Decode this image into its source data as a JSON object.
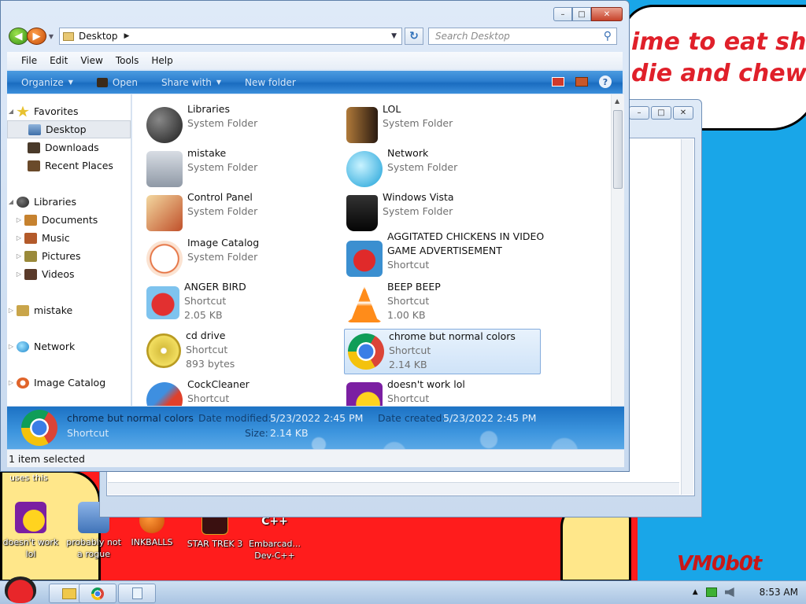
{
  "wallpaper": {
    "text": "ime to eat shi\ndie and chew\nm",
    "signature": "VM0b0t",
    "uses_this": "uses this"
  },
  "desktop_icons": [
    {
      "label": "doesn't work lol",
      "icon": "yahoo-messenger-icon"
    },
    {
      "label": "probably not a rogue",
      "icon": "gear-computer-icon"
    },
    {
      "label": "INKBALLS",
      "icon": "inkball-icon"
    },
    {
      "label": "STAR TREK 3",
      "icon": "star-wars-icon"
    },
    {
      "label": "Embarcad... Dev-C++",
      "icon": "dev-cpp-icon"
    }
  ],
  "explorer": {
    "address": "Desktop",
    "search_placeholder": "Search Desktop",
    "menu": [
      "File",
      "Edit",
      "View",
      "Tools",
      "Help"
    ],
    "commands": {
      "organize": "Organize",
      "open": "Open",
      "share": "Share with",
      "new_folder": "New folder"
    },
    "nav": {
      "favorites": "Favorites",
      "desktop": "Desktop",
      "downloads": "Downloads",
      "recent": "Recent Places",
      "libraries": "Libraries",
      "documents": "Documents",
      "music": "Music",
      "pictures": "Pictures",
      "videos": "Videos",
      "mistake": "mistake",
      "network": "Network",
      "image_catalog": "Image Catalog"
    },
    "items": [
      {
        "name": "Libraries",
        "type": "System Folder",
        "size": "",
        "icon": "libraries-icon"
      },
      {
        "name": "LOL",
        "type": "System Folder",
        "size": "",
        "icon": "user-folder-icon"
      },
      {
        "name": "mistake",
        "type": "System Folder",
        "size": "",
        "icon": "computer-icon"
      },
      {
        "name": "Network",
        "type": "System Folder",
        "size": "",
        "icon": "network-globe-icon"
      },
      {
        "name": "Control Panel",
        "type": "System Folder",
        "size": "",
        "icon": "control-panel-icon"
      },
      {
        "name": "Windows Vista",
        "type": "System Folder",
        "size": "",
        "icon": "recycle-bin-icon"
      },
      {
        "name": "Image Catalog",
        "type": "System Folder",
        "size": "",
        "icon": "image-catalog-icon"
      },
      {
        "name": "AGGITATED CHICKENS IN VIDEO GAME ADVERTISEMENT",
        "type": "Shortcut",
        "size": "",
        "icon": "angry-birds-icon"
      },
      {
        "name": "ANGER BIRD",
        "type": "Shortcut",
        "size": "2.05 KB",
        "icon": "angry-bird-icon"
      },
      {
        "name": "BEEP BEEP",
        "type": "Shortcut",
        "size": "1.00 KB",
        "icon": "vlc-cone-icon"
      },
      {
        "name": "cd drive",
        "type": "Shortcut",
        "size": "893 bytes",
        "icon": "cd-icon"
      },
      {
        "name": "chrome but normal colors",
        "type": "Shortcut",
        "size": "2.14 KB",
        "icon": "chrome-icon"
      },
      {
        "name": "CockCleaner",
        "type": "Shortcut",
        "size": "",
        "icon": "ccleaner-icon"
      },
      {
        "name": "doesn't work lol",
        "type": "Shortcut",
        "size": "",
        "icon": "yahoo-messenger-icon"
      }
    ],
    "details": {
      "name": "chrome but normal colors",
      "type": "Shortcut",
      "modified_label": "Date modified:",
      "modified": "5/23/2022 2:45 PM",
      "created_label": "Date created:",
      "created": "5/23/2022 2:45 PM",
      "size_label": "Size:",
      "size": "2.14 KB"
    },
    "status": "1 item selected"
  },
  "taskbar": {
    "clock": "8:53 AM"
  },
  "colors": {
    "command_bar": "#2d7fcf",
    "selection": "#cfe3f8",
    "wallpaper_blue": "#19a6e8",
    "wallpaper_red": "#ff1c1c"
  }
}
